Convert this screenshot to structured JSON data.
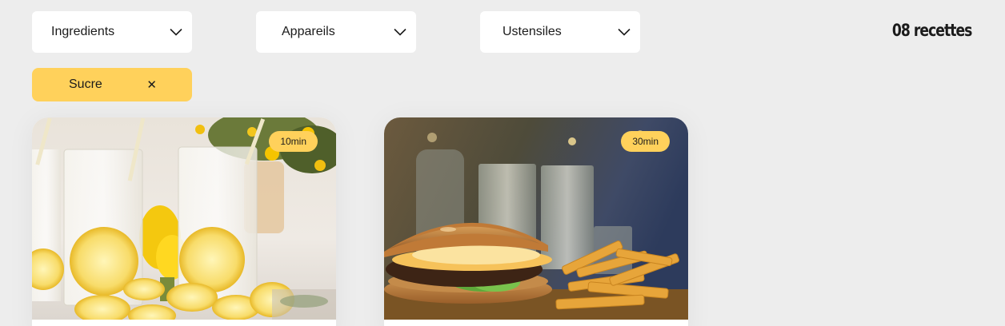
{
  "filters": [
    {
      "label": "Ingredients"
    },
    {
      "label": "Appareils"
    },
    {
      "label": "Ustensiles"
    }
  ],
  "recipe_count": "08 recettes",
  "selected_tags": [
    {
      "label": "Sucre",
      "close_symbol": "✕"
    }
  ],
  "recipes": [
    {
      "time": "10min",
      "image": "lemonade-photo"
    },
    {
      "time": "30min",
      "image": "burger-fries-photo"
    }
  ],
  "colors": {
    "background": "#ededed",
    "accent_yellow": "#ffd15b",
    "text_dark": "#1b1b1b"
  }
}
